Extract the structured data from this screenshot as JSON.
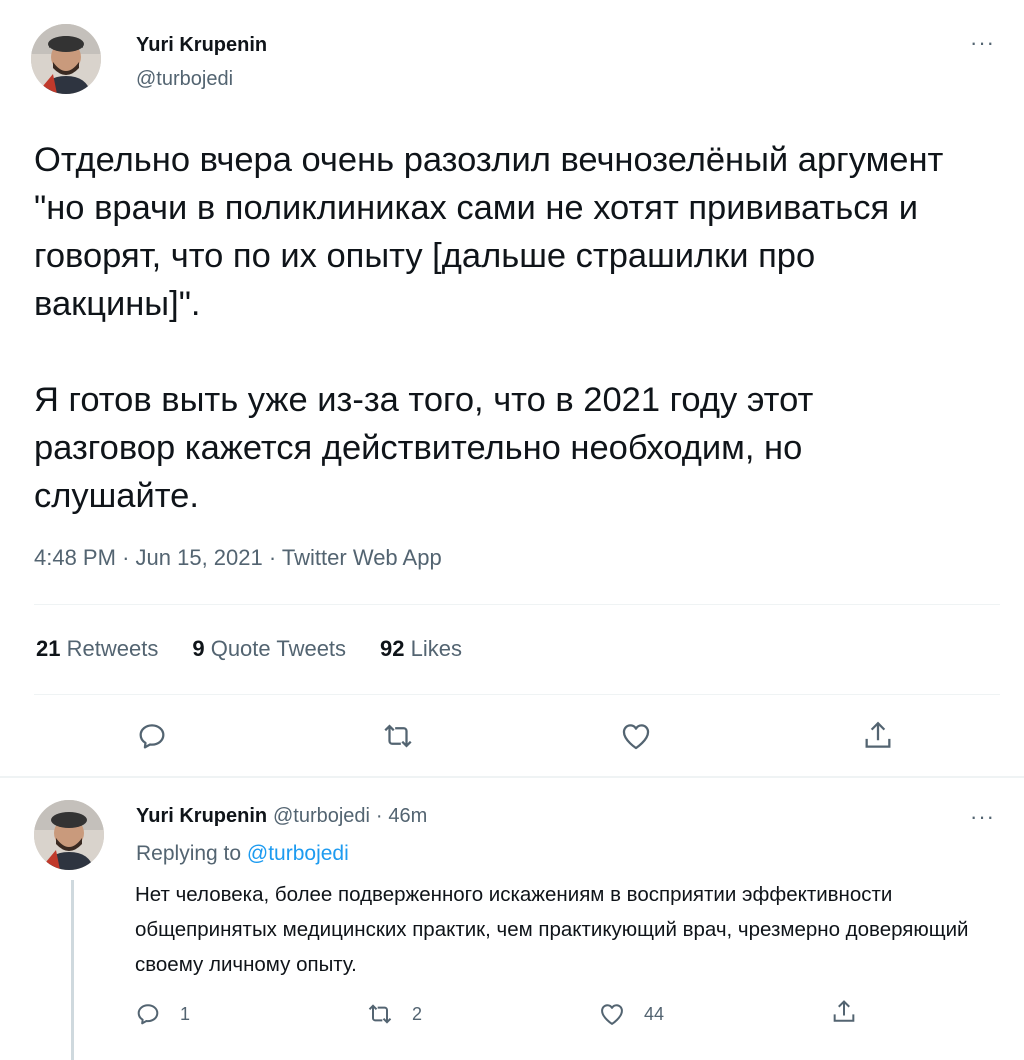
{
  "main_tweet": {
    "author_name": "Yuri Krupenin",
    "author_handle": "@turbojedi",
    "more_label": "···",
    "text": "Отдельно вчера очень разозлил вечнозелёный аргумент \"но врачи в поликлиниках сами не хотят прививаться и говорят, что по их опыту [дальше страшилки про вакцины]\".\n\nЯ готов выть уже из-за того, что в 2021 году этот разговор кажется действительно необходим, но слушайте.",
    "time": "4:48 PM",
    "date": "Jun 15, 2021",
    "source": "Twitter Web App",
    "sep": "·",
    "stats": {
      "retweets_count": "21",
      "retweets_label": "Retweets",
      "quotes_count": "9",
      "quotes_label": "Quote Tweets",
      "likes_count": "92",
      "likes_label": "Likes"
    },
    "actions": [
      "reply-icon",
      "retweet-icon",
      "like-icon",
      "share-icon"
    ]
  },
  "reply_tweet": {
    "author_name": "Yuri Krupenin",
    "author_handle": "@turbojedi",
    "sep": "·",
    "age": "46m",
    "more_label": "···",
    "replying_to_label": "Replying to",
    "replying_to_handle": "@turbojedi",
    "text": "Нет человека, более подверженного искажениям в восприятии эффективности общепринятых медицинских практик, чем практикующий врач, чрезмерно доверяющий своему личному опыту.",
    "reply_count": "1",
    "retweet_count": "2",
    "like_count": "44"
  },
  "colors": {
    "text_primary": "#0f1419",
    "text_secondary": "#536471",
    "accent": "#1d9bf0",
    "divider": "#eff3f4"
  }
}
